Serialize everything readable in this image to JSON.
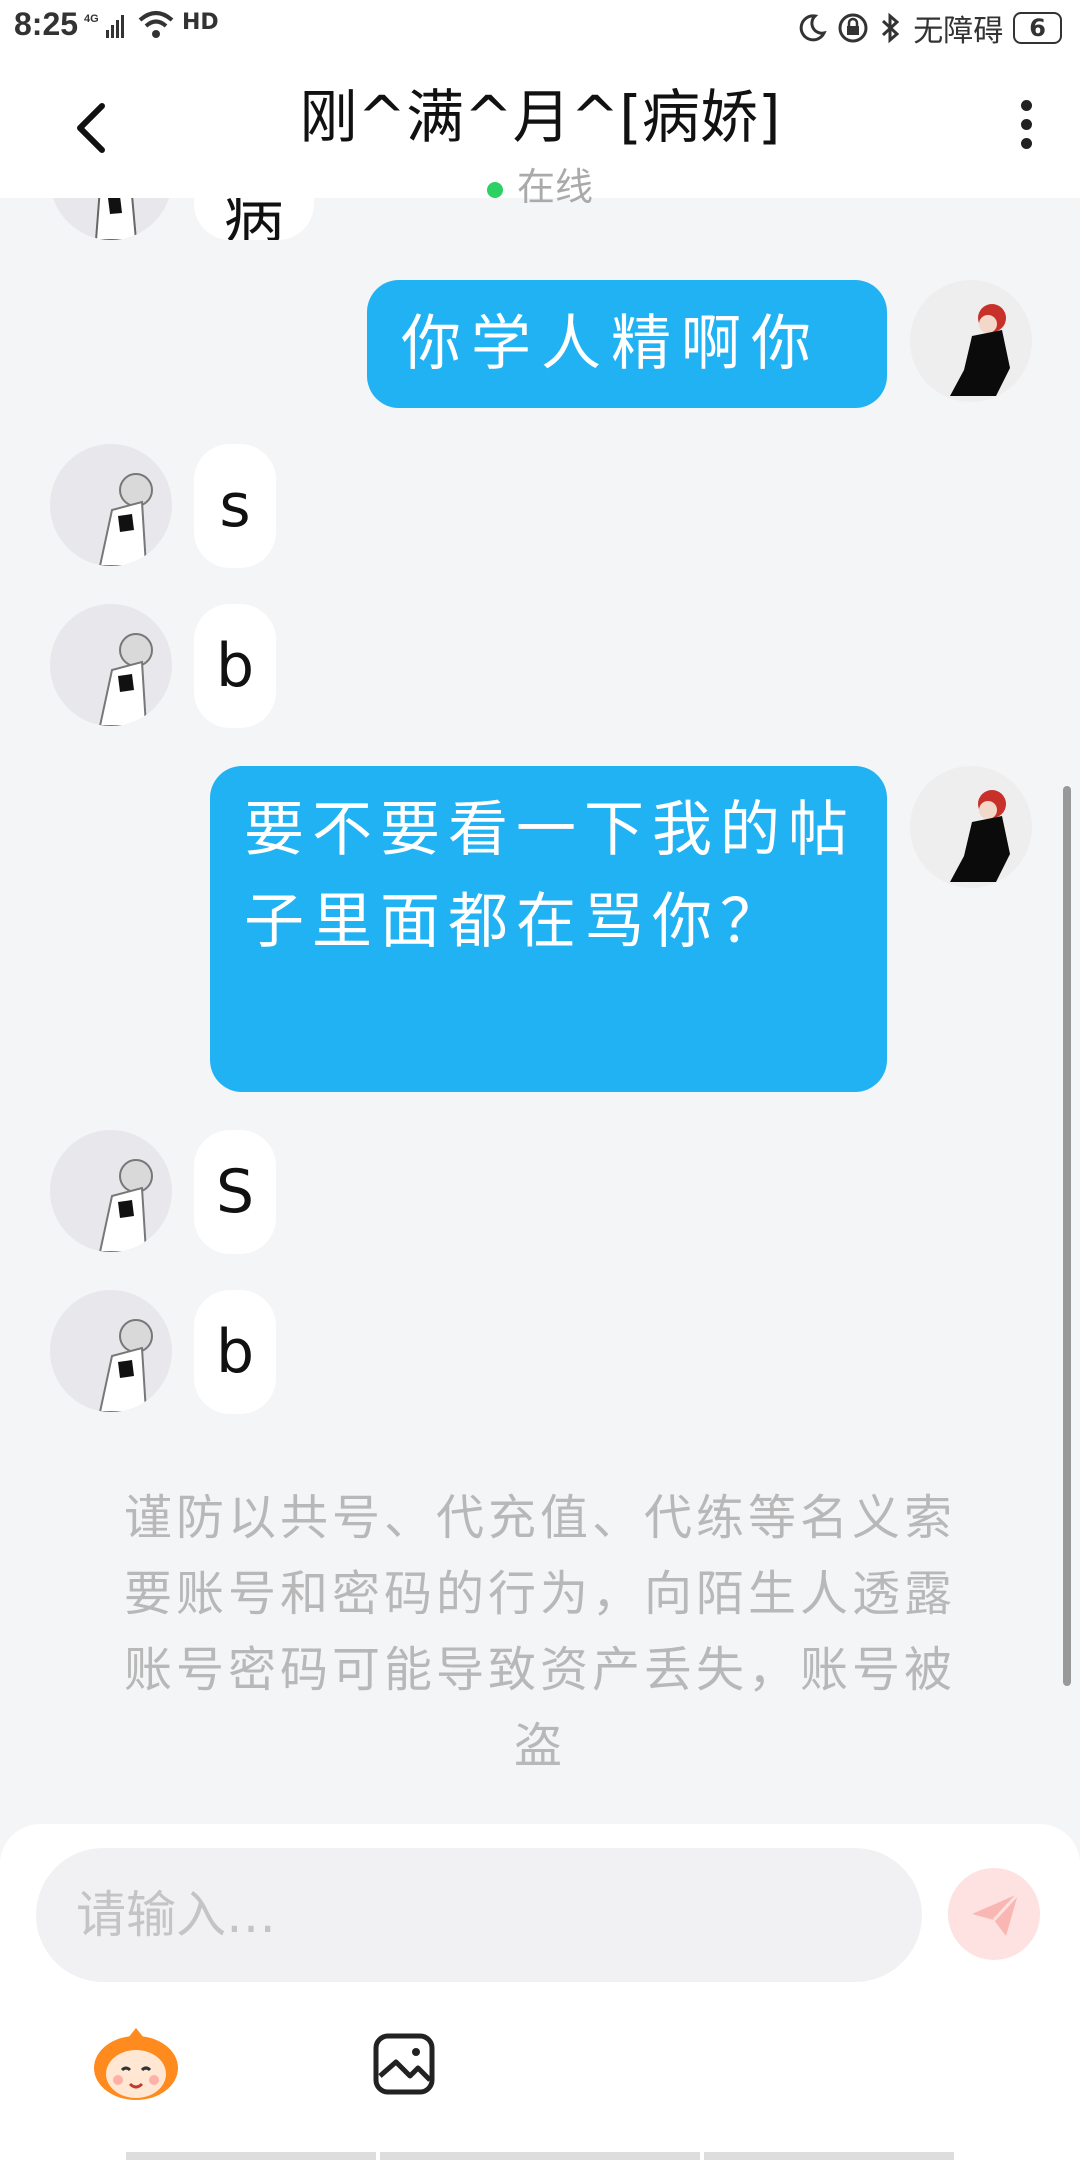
{
  "status_bar": {
    "time": "8:25",
    "network": "4G",
    "hd": "HD",
    "accessibility": "无障碍",
    "battery": "6"
  },
  "header": {
    "title": "刚^满^月^[病娇]",
    "status": "在线"
  },
  "messages": [
    {
      "side": "other",
      "text": "病"
    },
    {
      "side": "me",
      "text": "你学人精啊你"
    },
    {
      "side": "other",
      "text": "s"
    },
    {
      "side": "other",
      "text": "b"
    },
    {
      "side": "me",
      "text": "要不要看一下我的帖子里面都在骂你？"
    },
    {
      "side": "other",
      "text": "S"
    },
    {
      "side": "other",
      "text": "b"
    }
  ],
  "notice": "谨防以共号、代充值、代练等名义索要账号和密码的行为，向陌生人透露账号密码可能导致资产丢失，账号被盗",
  "composer": {
    "placeholder": "请输入…"
  },
  "icons": {
    "back": "back-arrow-icon",
    "more": "more-vertical-icon",
    "send": "send-icon",
    "emoji": "mascot-emoji-icon",
    "image": "image-icon"
  },
  "colors": {
    "my_bubble": "#21b2f3",
    "online_dot": "#2bd162",
    "send_button": "#fde2e1"
  }
}
